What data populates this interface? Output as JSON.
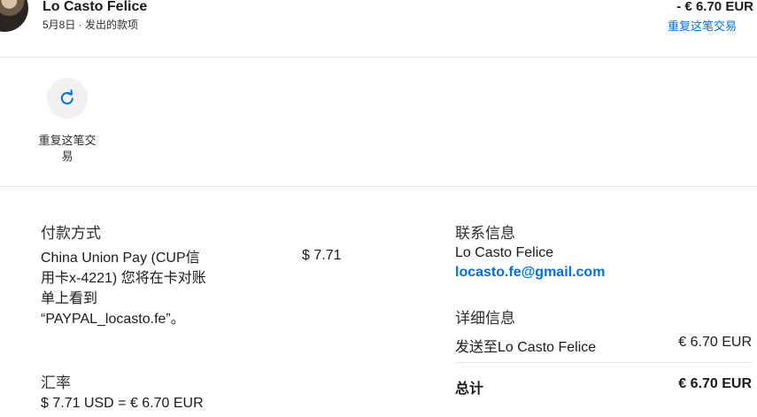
{
  "header": {
    "merchant_name": "Lo Casto Felice",
    "date_type": "5月8日 · 发出的款项",
    "amount": "- € 6.70 EUR",
    "repeat_link": "重复这笔交易"
  },
  "actions": {
    "repeat_label": "重复这笔交易",
    "repeat_icon": "refresh-icon"
  },
  "payment": {
    "title": "付款方式",
    "method_text": "China Union Pay (CUP信用卡x-4221) 您将在卡对账单上看到 “PAYPAL_locasto.fe”。",
    "amount": "$ 7.71"
  },
  "rate": {
    "title": "汇率",
    "value": "$ 7.71 USD = € 6.70 EUR"
  },
  "contact": {
    "title": "联系信息",
    "name": "Lo Casto Felice",
    "email": "locasto.fe@gmail.com"
  },
  "details": {
    "title": "详细信息",
    "sent_to_label": "发送至Lo Casto Felice",
    "sent_to_value": "€ 6.70 EUR",
    "total_label": "总计",
    "total_value": "€ 6.70 EUR"
  },
  "colors": {
    "link": "#0070e0",
    "text": "#2c2e2f",
    "divider": "#e6e6e6",
    "icon_bg": "#f1f1ef"
  }
}
